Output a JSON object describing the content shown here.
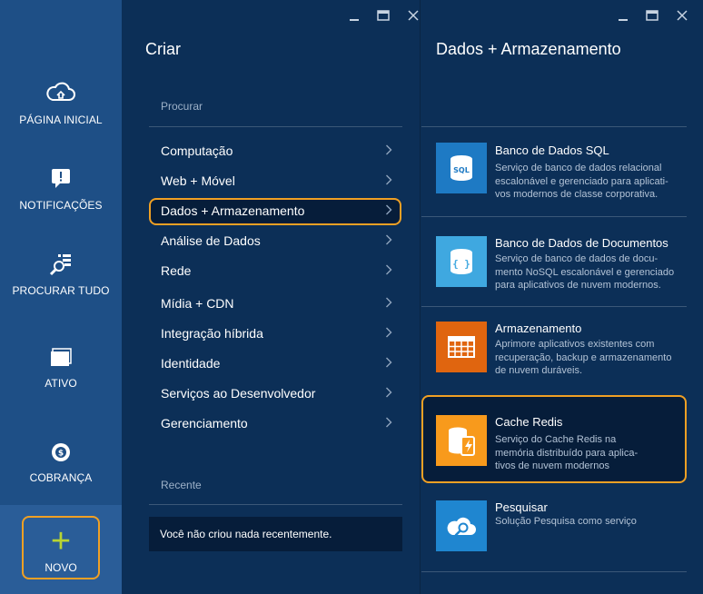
{
  "nav": {
    "items": [
      {
        "label": "PÁGINA INICIAL",
        "icon": "cloud-home-icon"
      },
      {
        "label": "NOTIFICAÇÕES",
        "icon": "notification-icon"
      },
      {
        "label": "PROCURAR TUDO",
        "icon": "browse-all-icon"
      },
      {
        "label": "ATIVO",
        "icon": "active-window-icon"
      },
      {
        "label": "COBRANÇA",
        "icon": "billing-icon"
      }
    ],
    "new_label": "NOVO"
  },
  "create": {
    "title": "Criar",
    "browse_label": "Procurar",
    "menu": [
      "Computação",
      "Web + Móvel",
      "Dados + Armazenamento",
      "Análise de Dados",
      "Rede",
      "Mídia + CDN",
      "Integração híbrida",
      "Identidade",
      "Serviços ao Desenvolvedor",
      "Gerenciamento"
    ],
    "selected_index": 2,
    "recent_label": "Recente",
    "recent_empty": "Você não criou nada recentemente."
  },
  "data_storage": {
    "title": "Dados + Armazenamento",
    "services": [
      {
        "name": "Banco de Dados SQL",
        "desc": [
          "Serviço de banco de dados relacional",
          "escalonável e gerenciado para aplicati-",
          "vos modernos de classe corporativa."
        ],
        "tile_label": "SQL",
        "icon": "sql-database-icon",
        "color": "#1e7ac4"
      },
      {
        "name": "Banco de Dados de Documentos",
        "desc": [
          "Serviço de banco de dados de docu-",
          "mento NoSQL escalonável e gerenciado",
          "para aplicativos de nuvem modernos."
        ],
        "tile_label": "{ }",
        "icon": "documentdb-icon",
        "color": "#3fa8e0"
      },
      {
        "name": "Armazenamento",
        "desc": [
          "Aprimore aplicativos existentes com",
          "recuperação, backup e armazenamento",
          "de nuvem duráveis."
        ],
        "icon": "storage-table-icon",
        "color": "#e0650f"
      },
      {
        "name": "Cache Redis",
        "desc": [
          "Serviço do Cache Redis na",
          "memória distribuído para aplica-",
          "tivos de nuvem modernos"
        ],
        "icon": "redis-cache-icon",
        "color": "#f89a1c"
      },
      {
        "name": "Pesquisar",
        "desc": [
          "Solução Pesquisa como serviço"
        ],
        "icon": "search-cloud-icon",
        "color": "#1f86d0"
      }
    ],
    "selected_index": 3
  },
  "colors": {
    "accent_outline": "#f0a024",
    "nav_bg": "#1e4f86",
    "blade_bg": "#0c2f57",
    "plus_green": "#b8d432"
  }
}
